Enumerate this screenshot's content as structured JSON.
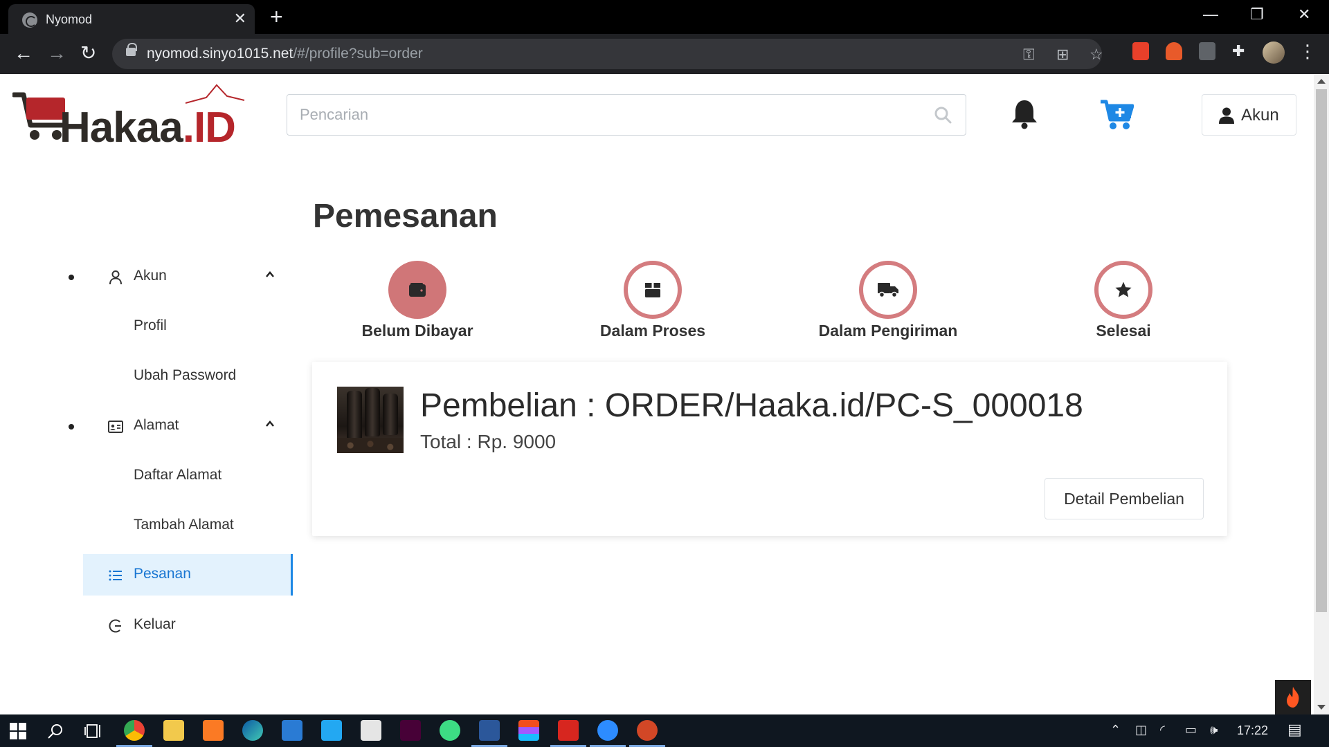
{
  "browser": {
    "tab_title": "Nyomod",
    "tab_close": "✕",
    "new_tab": "+",
    "url_host": "nyomod.sinyo1015.net",
    "url_path": "/#/profile?sub=order"
  },
  "header": {
    "logo_text_left": "Ha",
    "logo_text_mid": "kaa",
    "logo_text_right": ".ID",
    "search_placeholder": "Pencarian",
    "account_label": "Akun"
  },
  "sidebar": {
    "akun": "Akun",
    "profil": "Profil",
    "ubah_password": "Ubah Password",
    "alamat": "Alamat",
    "daftar_alamat": "Daftar Alamat",
    "tambah_alamat": "Tambah Alamat",
    "pesanan": "Pesanan",
    "keluar": "Keluar"
  },
  "main": {
    "title": "Pemesanan",
    "steps": [
      {
        "label": "Belum Dibayar",
        "icon": "wallet-icon",
        "state": "active"
      },
      {
        "label": "Dalam Proses",
        "icon": "box-icon",
        "state": "inactive"
      },
      {
        "label": "Dalam Pengiriman",
        "icon": "truck-icon",
        "state": "inactive"
      },
      {
        "label": "Selesai",
        "icon": "star-icon",
        "state": "inactive"
      }
    ],
    "order": {
      "title": "Pembelian : ORDER/Haaka.id/PC-S_000018",
      "total": "Total : Rp. 9000",
      "detail_button": "Detail Pembelian"
    }
  },
  "taskbar": {
    "time": "17:22"
  },
  "colors": {
    "accent_blue": "#1e88e5",
    "step_pink": "#d07678",
    "brand_red": "#b5262b"
  }
}
